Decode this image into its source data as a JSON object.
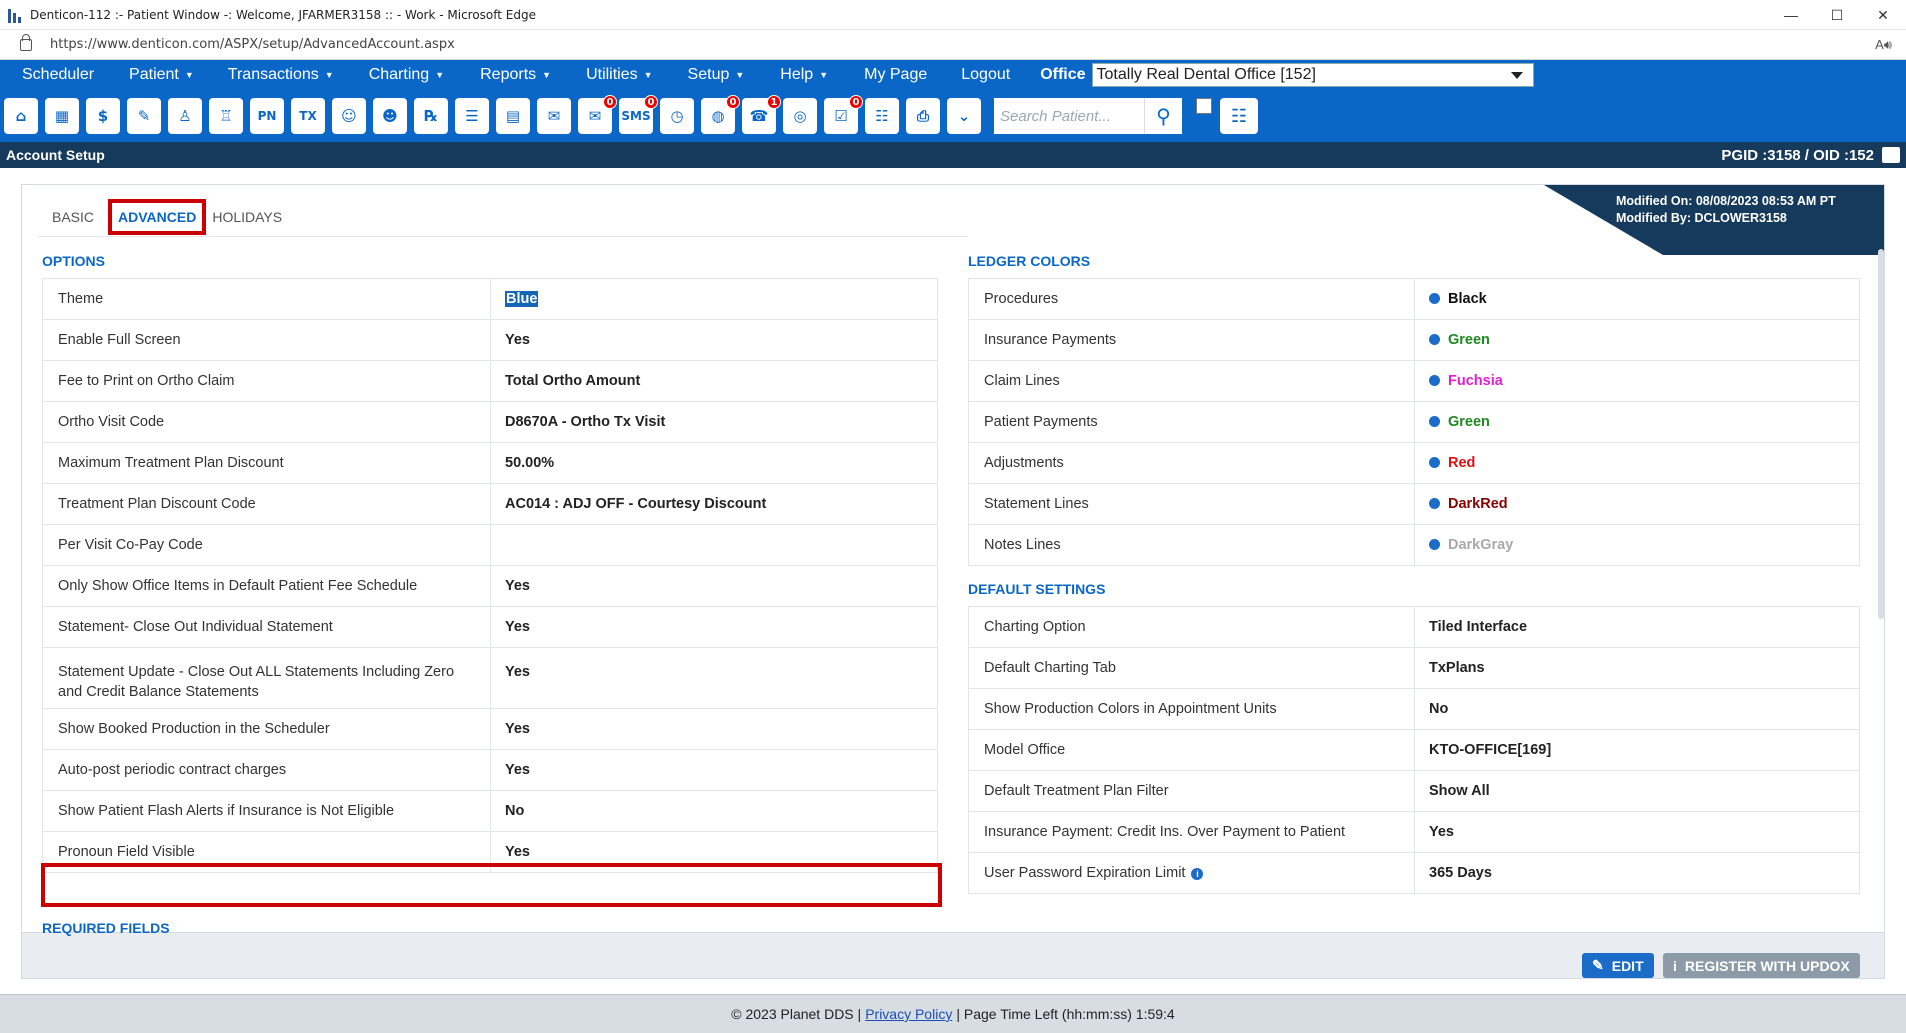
{
  "window": {
    "title": "Denticon-112 :- Patient Window -: Welcome, JFARMER3158 :: - Work - Microsoft Edge",
    "url": "https://www.denticon.com/ASPX/setup/AdvancedAccount.aspx",
    "minimize": "—",
    "maximize": "☐",
    "close": "✕"
  },
  "menu": {
    "items": [
      {
        "label": "Scheduler",
        "caret": false
      },
      {
        "label": "Patient",
        "caret": true
      },
      {
        "label": "Transactions",
        "caret": true
      },
      {
        "label": "Charting",
        "caret": true
      },
      {
        "label": "Reports",
        "caret": true
      },
      {
        "label": "Utilities",
        "caret": true
      },
      {
        "label": "Setup",
        "caret": true
      },
      {
        "label": "Help",
        "caret": true
      },
      {
        "label": "My Page",
        "caret": false
      },
      {
        "label": "Logout",
        "caret": false
      }
    ],
    "office_label": "Office",
    "office_value": "Totally Real Dental Office [152]"
  },
  "toolbar": {
    "icons": [
      {
        "name": "home-icon",
        "glyph": "⌂",
        "badge": ""
      },
      {
        "name": "calendar-icon",
        "glyph": "▦",
        "badge": ""
      },
      {
        "name": "dollar-icon",
        "glyph": "$",
        "badge": ""
      },
      {
        "name": "edit-note-icon",
        "glyph": "✎",
        "badge": ""
      },
      {
        "name": "tooth-icon",
        "glyph": "♙",
        "badge": ""
      },
      {
        "name": "tooth-roots-icon",
        "glyph": "♖",
        "badge": ""
      },
      {
        "name": "pn-icon",
        "glyph": "PN",
        "badge": ""
      },
      {
        "name": "tx-icon",
        "glyph": "TX",
        "badge": ""
      },
      {
        "name": "add-patient-icon",
        "glyph": "☺",
        "badge": ""
      },
      {
        "name": "patient-settings-icon",
        "glyph": "☻",
        "badge": ""
      },
      {
        "name": "rx-icon",
        "glyph": "℞",
        "badge": ""
      },
      {
        "name": "document-icon",
        "glyph": "☰",
        "badge": ""
      },
      {
        "name": "form-icon",
        "glyph": "▤",
        "badge": ""
      },
      {
        "name": "mail-icon",
        "glyph": "✉",
        "badge": ""
      },
      {
        "name": "message-icon",
        "glyph": "✉",
        "badge": "0"
      },
      {
        "name": "sms-icon",
        "glyph": "SMS",
        "badge": "0"
      },
      {
        "name": "clock-icon",
        "glyph": "◷",
        "badge": ""
      },
      {
        "name": "globe-user-icon",
        "glyph": "◍",
        "badge": "0"
      },
      {
        "name": "support-icon",
        "glyph": "☎",
        "badge": "1"
      },
      {
        "name": "globe-icon",
        "glyph": "◎",
        "badge": ""
      },
      {
        "name": "task-list-icon",
        "glyph": "☑",
        "badge": "0"
      },
      {
        "name": "people-icon",
        "glyph": "☷",
        "badge": ""
      },
      {
        "name": "printer-icon",
        "glyph": "⎙",
        "badge": ""
      },
      {
        "name": "chevron-down-icon",
        "glyph": "⌄",
        "badge": ""
      }
    ],
    "search_placeholder": "Search Patient..."
  },
  "page_header": {
    "title": "Account Setup",
    "ids": "PGID :3158  /  OID :152"
  },
  "tabs": [
    "BASIC",
    "ADVANCED",
    "HOLIDAYS"
  ],
  "modified": {
    "on": "Modified On: 08/08/2023 08:53 AM PT",
    "by": "Modified By: DCLOWER3158"
  },
  "options": {
    "title": "OPTIONS",
    "rows": [
      {
        "label": "Theme",
        "value": "Blue"
      },
      {
        "label": "Enable Full Screen",
        "value": "Yes"
      },
      {
        "label": "Fee to Print on Ortho Claim",
        "value": "Total Ortho Amount"
      },
      {
        "label": "Ortho Visit Code",
        "value": "D8670A - Ortho Tx Visit"
      },
      {
        "label": "Maximum Treatment Plan Discount",
        "value": "50.00%"
      },
      {
        "label": "Treatment Plan Discount Code",
        "value": "AC014 : ADJ OFF - Courtesy Discount"
      },
      {
        "label": "Per Visit Co-Pay Code",
        "value": ""
      },
      {
        "label": "Only Show Office Items in Default Patient Fee Schedule",
        "value": "Yes"
      },
      {
        "label": "Statement- Close Out Individual Statement",
        "value": "Yes"
      },
      {
        "label": "Statement Update - Close Out ALL Statements Including Zero and Credit Balance Statements",
        "value": "Yes"
      },
      {
        "label": "Show Booked Production in the Scheduler",
        "value": "Yes"
      },
      {
        "label": "Auto-post periodic contract charges",
        "value": "Yes"
      },
      {
        "label": "Show Patient Flash Alerts if Insurance is Not Eligible",
        "value": "No"
      },
      {
        "label": "Pronoun Field Visible",
        "value": "Yes"
      }
    ]
  },
  "required_fields": {
    "title": "REQUIRED FIELDS"
  },
  "ledger_colors": {
    "title": "LEDGER COLORS",
    "rows": [
      {
        "label": "Procedures",
        "value": "Black",
        "color": "#111111"
      },
      {
        "label": "Insurance Payments",
        "value": "Green",
        "color": "#1f8a1f"
      },
      {
        "label": "Claim Lines",
        "value": "Fuchsia",
        "color": "#e11ed2"
      },
      {
        "label": "Patient Payments",
        "value": "Green",
        "color": "#1f8a1f"
      },
      {
        "label": "Adjustments",
        "value": "Red",
        "color": "#e01010"
      },
      {
        "label": "Statement Lines",
        "value": "DarkRed",
        "color": "#8b0000"
      },
      {
        "label": "Notes Lines",
        "value": "DarkGray",
        "color": "#a9a9a9"
      }
    ]
  },
  "default_settings": {
    "title": "DEFAULT SETTINGS",
    "rows": [
      {
        "label": "Charting Option",
        "value": "Tiled Interface"
      },
      {
        "label": "Default Charting Tab",
        "value": "TxPlans"
      },
      {
        "label": "Show Production Colors in Appointment Units",
        "value": "No"
      },
      {
        "label": "Model Office",
        "value": "KTO-OFFICE[169]"
      },
      {
        "label": "Default Treatment Plan Filter",
        "value": "Show All"
      },
      {
        "label": "Insurance Payment: Credit Ins. Over Payment to Patient",
        "value": "Yes"
      },
      {
        "label": "User Password Expiration Limit",
        "value": "365 Days"
      }
    ]
  },
  "buttons": {
    "edit": "EDIT",
    "register": "REGISTER WITH UPDOX"
  },
  "footer": {
    "copyright": "© 2023 Planet DDS |",
    "privacy": "Privacy Policy",
    "time": "|  Page Time Left (hh:mm:ss) 1:59:4"
  },
  "colors": {
    "brand_blue": "#0b67c7",
    "dark_navy": "#163a5c",
    "highlight_red": "#cc0000",
    "edit_button": "#1a6cc8",
    "register_button": "#8d9aa8"
  }
}
